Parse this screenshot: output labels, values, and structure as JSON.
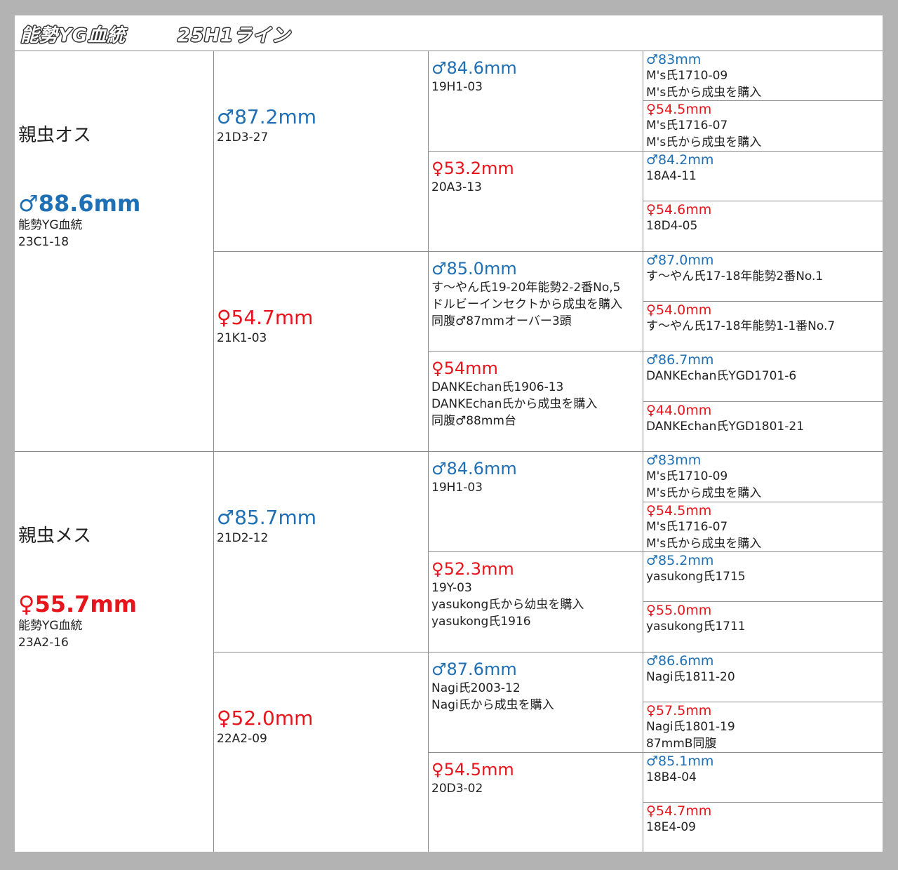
{
  "title": "能勢YG血統",
  "line_name": "25H1ライン",
  "colors": {
    "male": "#1f6fb5",
    "female": "#e8141c",
    "background": "#b3b3b3",
    "grid": "#8c8c8c"
  },
  "parents": [
    {
      "label": "親虫オス",
      "size": "♂88.6mm",
      "sex": "male",
      "lines": [
        "能勢YG血統",
        "23C1-18"
      ],
      "gen1": [
        {
          "size": "♂87.2mm",
          "sex": "male",
          "lines": [
            "21D3-27"
          ],
          "gen2": [
            {
              "size": "♂84.6mm",
              "sex": "male",
              "lines": [
                "19H1-03"
              ],
              "gen3": [
                {
                  "size": "♂83mm",
                  "sex": "male",
                  "lines": [
                    "M's氏1710-09",
                    "M's氏から成虫を購入"
                  ]
                },
                {
                  "size": "♀54.5mm",
                  "sex": "female",
                  "lines": [
                    "M's氏1716-07",
                    "M's氏から成虫を購入"
                  ]
                }
              ]
            },
            {
              "size": "♀53.2mm",
              "sex": "female",
              "lines": [
                "20A3-13"
              ],
              "gen3": [
                {
                  "size": "♂84.2mm",
                  "sex": "male",
                  "lines": [
                    "18A4-11"
                  ]
                },
                {
                  "size": "♀54.6mm",
                  "sex": "female",
                  "lines": [
                    "18D4-05"
                  ]
                }
              ]
            }
          ]
        },
        {
          "size": "♀54.7mm",
          "sex": "female",
          "lines": [
            "21K1-03"
          ],
          "gen2": [
            {
              "size": "♂85.0mm",
              "sex": "male",
              "lines": [
                "す～やん氏19-20年能勢2-2番No,5",
                "ドルビーインセクトから成虫を購入",
                "同腹♂87mmオーバー3頭"
              ],
              "gen3": [
                {
                  "size": "♂87.0mm",
                  "sex": "male",
                  "lines": [
                    "す～やん氏17-18年能勢2番No.1"
                  ]
                },
                {
                  "size": "♀54.0mm",
                  "sex": "female",
                  "lines": [
                    "す～やん氏17-18年能勢1-1番No.7"
                  ]
                }
              ]
            },
            {
              "size": "♀54mm",
              "sex": "female",
              "lines": [
                "DANKEchan氏1906-13",
                "DANKEchan氏から成虫を購入",
                "同腹♂88mm台"
              ],
              "gen3": [
                {
                  "size": "♂86.7mm",
                  "sex": "male",
                  "lines": [
                    "DANKEchan氏YGD1701-6"
                  ]
                },
                {
                  "size": "♀44.0mm",
                  "sex": "female",
                  "lines": [
                    "DANKEchan氏YGD1801-21"
                  ]
                }
              ]
            }
          ]
        }
      ]
    },
    {
      "label": "親虫メス",
      "size": "♀55.7mm",
      "sex": "female",
      "lines": [
        "能勢YG血統",
        "23A2-16"
      ],
      "gen1": [
        {
          "size": "♂85.7mm",
          "sex": "male",
          "lines": [
            "21D2-12"
          ],
          "gen2": [
            {
              "size": "♂84.6mm",
              "sex": "male",
              "lines": [
                "19H1-03"
              ],
              "gen3": [
                {
                  "size": "♂83mm",
                  "sex": "male",
                  "lines": [
                    "M's氏1710-09",
                    "M's氏から成虫を購入"
                  ]
                },
                {
                  "size": "♀54.5mm",
                  "sex": "female",
                  "lines": [
                    "M's氏1716-07",
                    "M's氏から成虫を購入"
                  ]
                }
              ]
            },
            {
              "size": "♀52.3mm",
              "sex": "female",
              "lines": [
                "19Y-03",
                "yasukong氏から幼虫を購入",
                "yasukong氏1916"
              ],
              "gen3": [
                {
                  "size": "♂85.2mm",
                  "sex": "male",
                  "lines": [
                    "yasukong氏1715"
                  ]
                },
                {
                  "size": "♀55.0mm",
                  "sex": "female",
                  "lines": [
                    "yasukong氏1711"
                  ]
                }
              ]
            }
          ]
        },
        {
          "size": "♀52.0mm",
          "sex": "female",
          "lines": [
            "22A2-09"
          ],
          "gen2": [
            {
              "size": "♂87.6mm",
              "sex": "male",
              "lines": [
                "Nagi氏2003-12",
                "Nagi氏から成虫を購入"
              ],
              "gen3": [
                {
                  "size": "♂86.6mm",
                  "sex": "male",
                  "lines": [
                    "Nagi氏1811-20"
                  ]
                },
                {
                  "size": "♀57.5mm",
                  "sex": "female",
                  "lines": [
                    "Nagi氏1801-19",
                    "87mmB同腹"
                  ]
                }
              ]
            },
            {
              "size": "♀54.5mm",
              "sex": "female",
              "lines": [
                "20D3-02"
              ],
              "gen3": [
                {
                  "size": "♂85.1mm",
                  "sex": "male",
                  "lines": [
                    "18B4-04"
                  ]
                },
                {
                  "size": "♀54.7mm",
                  "sex": "female",
                  "lines": [
                    "18E4-09"
                  ]
                }
              ]
            }
          ]
        }
      ]
    }
  ]
}
